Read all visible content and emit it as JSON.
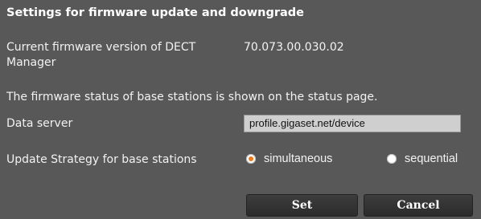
{
  "section": {
    "title": "Settings for firmware update and downgrade"
  },
  "firmware": {
    "current_label": "Current firmware version of DECT Manager",
    "current_value": "70.073.00.030.02",
    "status_note": "The firmware status of base stations is shown on the status page."
  },
  "data_server": {
    "label": "Data server",
    "value": "profile.gigaset.net/device"
  },
  "update_strategy": {
    "label": "Update Strategy for base stations",
    "options": [
      {
        "label": "simultaneous",
        "selected": true
      },
      {
        "label": "sequential",
        "selected": false
      }
    ],
    "accent_color": "#f07a1a"
  },
  "buttons": {
    "set": "Set",
    "cancel": "Cancel"
  }
}
